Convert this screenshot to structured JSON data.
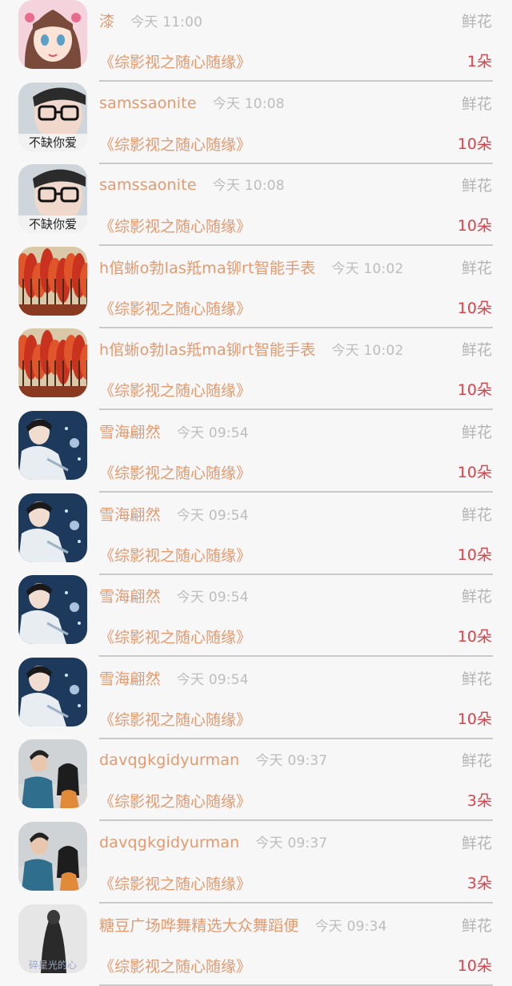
{
  "rows": [
    {
      "name": "漆",
      "time": "今天 11:00",
      "type": "鲜花",
      "book": "《综影视之随心随缘》",
      "count": "1朵",
      "avatar": "anime-girl"
    },
    {
      "name": "samssaonite",
      "time": "今天 10:08",
      "type": "鲜花",
      "book": "《综影视之随心随缘》",
      "count": "10朵",
      "avatar": "glasses-boy",
      "avatar_caption": "不缺你爱"
    },
    {
      "name": "samssaonite",
      "time": "今天 10:08",
      "type": "鲜花",
      "book": "《综影视之随心随缘》",
      "count": "10朵",
      "avatar": "glasses-boy",
      "avatar_caption": "不缺你爱"
    },
    {
      "name": "h倌蜥o勃las羝ma铆rt智能手表",
      "time": "今天 10:02",
      "type": "鲜花",
      "book": "《综影视之随心随缘》",
      "count": "10朵",
      "avatar": "red-forest"
    },
    {
      "name": "h倌蜥o勃las羝ma铆rt智能手表",
      "time": "今天 10:02",
      "type": "鲜花",
      "book": "《综影视之随心随缘》",
      "count": "10朵",
      "avatar": "red-forest"
    },
    {
      "name": "雪海翩然",
      "time": "今天 09:54",
      "type": "鲜花",
      "book": "《综影视之随心随缘》",
      "count": "10朵",
      "avatar": "night-man"
    },
    {
      "name": "雪海翩然",
      "time": "今天 09:54",
      "type": "鲜花",
      "book": "《综影视之随心随缘》",
      "count": "10朵",
      "avatar": "night-man"
    },
    {
      "name": "雪海翩然",
      "time": "今天 09:54",
      "type": "鲜花",
      "book": "《综影视之随心随缘》",
      "count": "10朵",
      "avatar": "night-man"
    },
    {
      "name": "雪海翩然",
      "time": "今天 09:54",
      "type": "鲜花",
      "book": "《综影视之随心随缘》",
      "count": "10朵",
      "avatar": "night-man"
    },
    {
      "name": "davqgkgidyurman",
      "time": "今天 09:37",
      "type": "鲜花",
      "book": "《综影视之随心随缘》",
      "count": "3朵",
      "avatar": "couple"
    },
    {
      "name": "davqgkgidyurman",
      "time": "今天 09:37",
      "type": "鲜花",
      "book": "《综影视之随心随缘》",
      "count": "3朵",
      "avatar": "couple"
    },
    {
      "name": "糖豆广场哗舞精选大众舞蹈便",
      "time": "今天 09:34",
      "type": "鲜花",
      "book": "《综影视之随心随缘》",
      "count": "10朵",
      "avatar": "dark-figure",
      "avatar_caption": "碎星光的心"
    }
  ]
}
